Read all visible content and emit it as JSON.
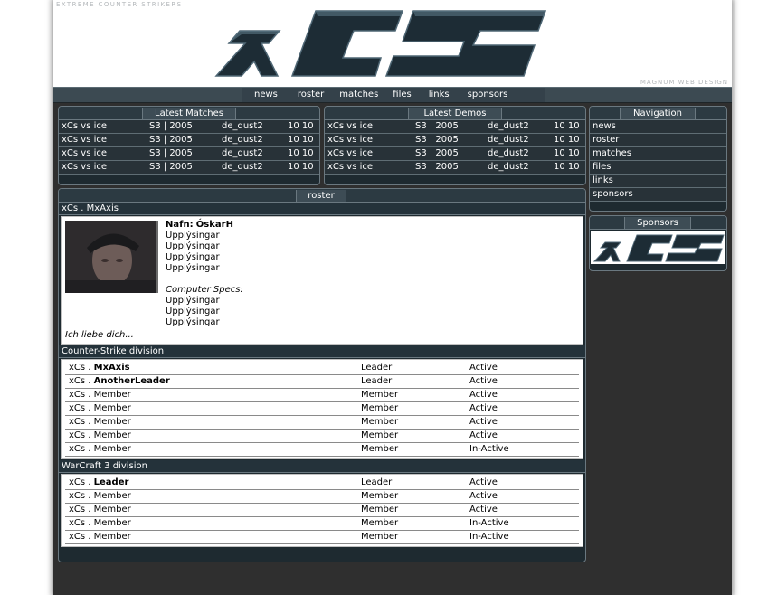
{
  "header": {
    "tagline": "EXTREME COUNTER STRIKERS",
    "credit": "MAGNUM WEB DESIGN",
    "logo_text": "xCs"
  },
  "nav": [
    "news",
    "roster",
    "matches",
    "files",
    "links",
    "sponsors"
  ],
  "latest_matches": {
    "title": "Latest Matches",
    "rows": [
      {
        "teams": "xCs vs ice",
        "season": "S3 | 2005",
        "map": "de_dust2",
        "score": "10 10"
      },
      {
        "teams": "xCs vs ice",
        "season": "S3 | 2005",
        "map": "de_dust2",
        "score": "10 10"
      },
      {
        "teams": "xCs vs ice",
        "season": "S3 | 2005",
        "map": "de_dust2",
        "score": "10 10"
      },
      {
        "teams": "xCs vs ice",
        "season": "S3 | 2005",
        "map": "de_dust2",
        "score": "10 10"
      }
    ]
  },
  "latest_demos": {
    "title": "Latest Demos",
    "rows": [
      {
        "teams": "xCs vs ice",
        "season": "S3 | 2005",
        "map": "de_dust2",
        "score": "10 10"
      },
      {
        "teams": "xCs vs ice",
        "season": "S3 | 2005",
        "map": "de_dust2",
        "score": "10 10"
      },
      {
        "teams": "xCs vs ice",
        "season": "S3 | 2005",
        "map": "de_dust2",
        "score": "10 10"
      },
      {
        "teams": "xCs vs ice",
        "season": "S3 | 2005",
        "map": "de_dust2",
        "score": "10 10"
      }
    ]
  },
  "navigation": {
    "title": "Navigation",
    "items": [
      "news",
      "roster",
      "matches",
      "files",
      "links",
      "sponsors"
    ]
  },
  "sponsors": {
    "title": "Sponsors",
    "banner_text": "xCs"
  },
  "roster": {
    "title": "roster",
    "player_bar": "xCs . MxAxis",
    "profile": {
      "name_label": "Nafn:",
      "name_value": "ÓskarH",
      "info": [
        "Upplýsingar",
        "Upplýsingar",
        "Upplýsingar",
        "Upplýsingar"
      ],
      "specs_label": "Computer Specs:",
      "specs": [
        "Upplýsingar",
        "Upplýsingar",
        "Upplýsingar"
      ],
      "quote": "Ich liebe dich..."
    },
    "divisions": [
      {
        "title": "Counter-Strike division",
        "members": [
          {
            "prefix": "xCs . ",
            "name": "MxAxis",
            "bold": true,
            "role": "Leader",
            "status": "Active"
          },
          {
            "prefix": "xCs . ",
            "name": "AnotherLeader",
            "bold": true,
            "role": "Leader",
            "status": "Active"
          },
          {
            "prefix": "xCs . ",
            "name": "Member",
            "bold": false,
            "role": "Member",
            "status": "Active"
          },
          {
            "prefix": "xCs . ",
            "name": "Member",
            "bold": false,
            "role": "Member",
            "status": "Active"
          },
          {
            "prefix": "xCs . ",
            "name": "Member",
            "bold": false,
            "role": "Member",
            "status": "Active"
          },
          {
            "prefix": "xCs . ",
            "name": "Member",
            "bold": false,
            "role": "Member",
            "status": "Active"
          },
          {
            "prefix": "xCs . ",
            "name": "Member",
            "bold": false,
            "role": "Member",
            "status": "In-Active"
          }
        ]
      },
      {
        "title": "WarCraft 3 division",
        "members": [
          {
            "prefix": "xCs . ",
            "name": "Leader",
            "bold": true,
            "role": "Leader",
            "status": "Active"
          },
          {
            "prefix": "xCs . ",
            "name": "Member",
            "bold": false,
            "role": "Member",
            "status": "Active"
          },
          {
            "prefix": "xCs . ",
            "name": "Member",
            "bold": false,
            "role": "Member",
            "status": "Active"
          },
          {
            "prefix": "xCs . ",
            "name": "Member",
            "bold": false,
            "role": "Member",
            "status": "In-Active"
          },
          {
            "prefix": "xCs . ",
            "name": "Member",
            "bold": false,
            "role": "Member",
            "status": "In-Active"
          }
        ]
      }
    ]
  },
  "colors": {
    "shell": "#2f2f2f",
    "panel": "#1e2a30",
    "panel_border": "#6a7880",
    "logo_dark": "#1b2a33",
    "logo_light": "#4a6270"
  }
}
